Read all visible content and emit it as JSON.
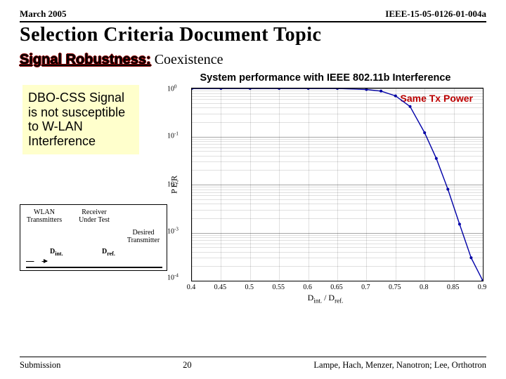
{
  "header": {
    "date": "March 2005",
    "docid": "IEEE-15-05-0126-01-004a"
  },
  "title": "Selection Criteria Document Topic",
  "subtitle": {
    "strong": "Signal Robustness:",
    "rest": " Coexistence"
  },
  "callout": "DBO-CSS Signal is not susceptible to W-LAN Interference",
  "diagram": {
    "wlan": "WLAN Transmitters",
    "receiver": "Receiver Under Test",
    "desired": "Desired Transmitter",
    "dint": "D",
    "dint_sub": "int.",
    "dref": "D",
    "dref_sub": "ref."
  },
  "chart_data": {
    "type": "line",
    "title": "System performance with IEEE 802.11b Interference",
    "ylabel": "PER",
    "xlabel_html": "D<sub>int.</sub> / D<sub>ref.</sub>",
    "annotation": "Same Tx Power",
    "xlim": [
      0.4,
      0.9
    ],
    "ylim_log10": [
      -4,
      0
    ],
    "x": [
      0.4,
      0.45,
      0.5,
      0.55,
      0.6,
      0.65,
      0.7,
      0.725,
      0.75,
      0.775,
      0.8,
      0.82,
      0.84,
      0.86,
      0.88,
      0.9
    ],
    "y": [
      1.0,
      1.0,
      1.0,
      1.0,
      1.0,
      1.0,
      0.95,
      0.88,
      0.7,
      0.42,
      0.12,
      0.035,
      0.008,
      0.0015,
      0.0003,
      0.0001
    ],
    "xticks": [
      0.4,
      0.45,
      0.5,
      0.55,
      0.6,
      0.65,
      0.7,
      0.75,
      0.8,
      0.85,
      0.9
    ],
    "yticks": [
      0,
      -1,
      -2,
      -3,
      -4
    ]
  },
  "footer": {
    "left": "Submission",
    "center": "20",
    "right": "Lampe, Hach, Menzer, Nanotron; Lee, Orthotron"
  }
}
